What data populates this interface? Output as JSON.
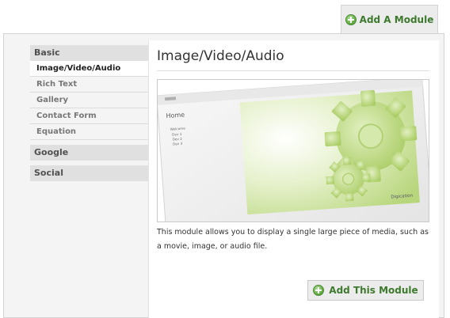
{
  "header": {
    "add_module_label": "Add A Module"
  },
  "sidebar": {
    "categories": [
      {
        "label": "Basic",
        "items": [
          {
            "label": "Image/Video/Audio",
            "active": true
          },
          {
            "label": "Rich Text"
          },
          {
            "label": "Gallery"
          },
          {
            "label": "Contact Form"
          },
          {
            "label": "Equation"
          }
        ]
      },
      {
        "label": "Google"
      },
      {
        "label": "Social"
      }
    ]
  },
  "main": {
    "title": "Image/Video/Audio",
    "description": "This module allows you to display a single large piece of media, such as a movie, image, or audio file.",
    "add_button_label": "Add This Module",
    "preview": {
      "page_heading": "Home",
      "nav_items": [
        "Welcome",
        "Dev 1",
        "Dev 2",
        "Dev 3"
      ],
      "brand": "Digication"
    }
  },
  "colors": {
    "accent_green": "#3d7a2d",
    "panel_gray": "#f4f4f4",
    "category_gray": "#e0e0e0"
  },
  "icons": {
    "add": "plus-circle-icon",
    "preview_graphic": "gears-icon"
  }
}
